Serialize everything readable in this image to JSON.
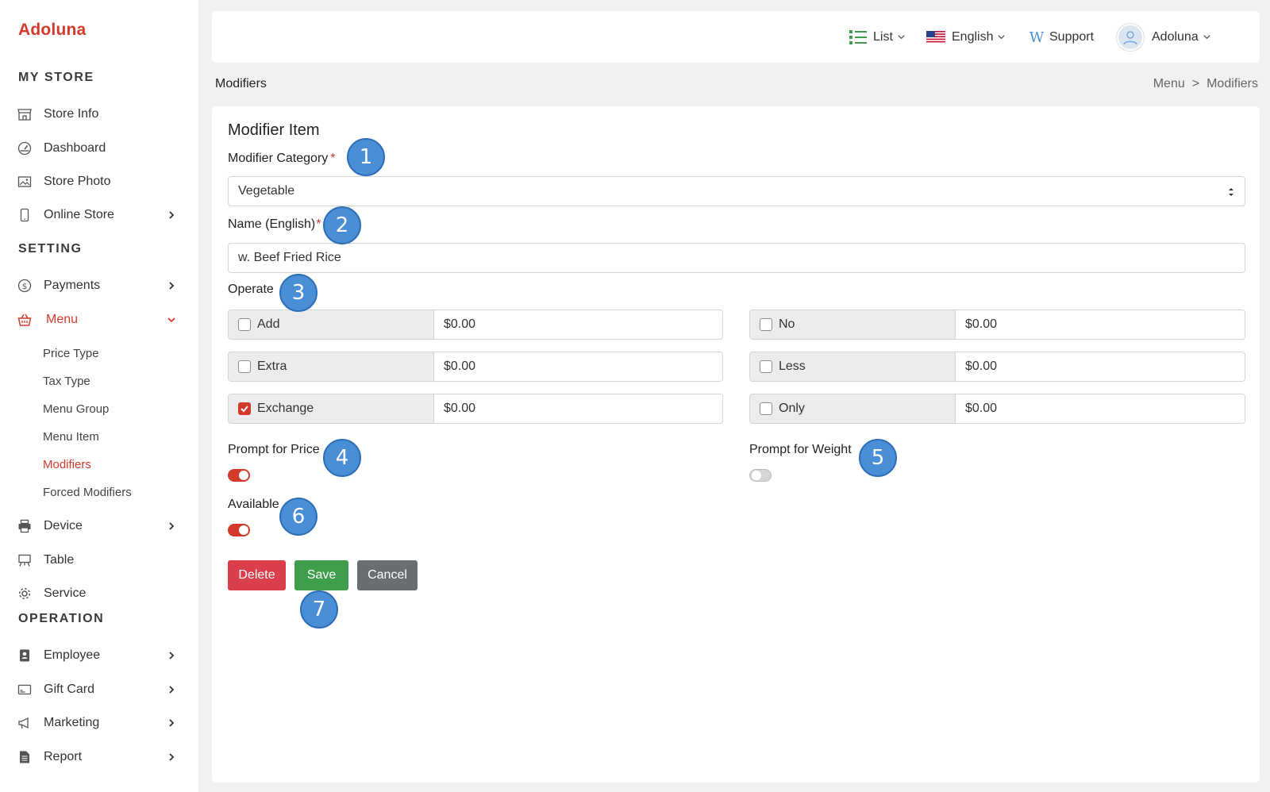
{
  "brand": "Adoluna",
  "sidebar": {
    "my_store_heading": "MY STORE",
    "setting_heading": "SETTING",
    "operation_heading": "OPERATION",
    "items": {
      "store_info": "Store Info",
      "dashboard": "Dashboard",
      "store_photo": "Store Photo",
      "online_store": "Online Store",
      "payments": "Payments",
      "menu": "Menu",
      "device": "Device",
      "table": "Table",
      "service": "Service",
      "employee": "Employee",
      "gift_card": "Gift Card",
      "marketing": "Marketing",
      "report": "Report"
    },
    "menu_sub": {
      "price_type": "Price Type",
      "tax_type": "Tax Type",
      "menu_group": "Menu Group",
      "menu_item": "Menu Item",
      "modifiers": "Modifiers",
      "forced_modifiers": "Forced Modifiers"
    }
  },
  "topbar": {
    "list": "List",
    "language": "English",
    "support": "Support",
    "user": "Adoluna"
  },
  "page": {
    "title": "Modifiers",
    "breadcrumb": [
      "Menu",
      ">",
      "Modifiers"
    ]
  },
  "form": {
    "card_title": "Modifier Item",
    "category_label": "Modifier Category",
    "category_value": "Vegetable",
    "name_label": "Name (English)",
    "name_value": "w. Beef Fried Rice",
    "operate_label": "Operate",
    "operate": {
      "add": {
        "label": "Add",
        "price": "$0.00",
        "checked": false
      },
      "extra": {
        "label": "Extra",
        "price": "$0.00",
        "checked": false
      },
      "exchange": {
        "label": "Exchange",
        "price": "$0.00",
        "checked": true
      },
      "no": {
        "label": "No",
        "price": "$0.00",
        "checked": false
      },
      "less": {
        "label": "Less",
        "price": "$0.00",
        "checked": false
      },
      "only": {
        "label": "Only",
        "price": "$0.00",
        "checked": false
      }
    },
    "prompt_price_label": "Prompt for Price",
    "prompt_price_on": true,
    "prompt_weight_label": "Prompt for Weight",
    "prompt_weight_on": false,
    "available_label": "Available",
    "available_on": true,
    "buttons": {
      "delete": "Delete",
      "save": "Save",
      "cancel": "Cancel"
    }
  },
  "callouts": [
    "1",
    "2",
    "3",
    "4",
    "5",
    "6",
    "7"
  ],
  "colors": {
    "accent": "#d33a2c",
    "save": "#3f9e4b",
    "delete": "#d9404b",
    "cancel": "#6a6d71",
    "callout": "#4a8fd6"
  }
}
